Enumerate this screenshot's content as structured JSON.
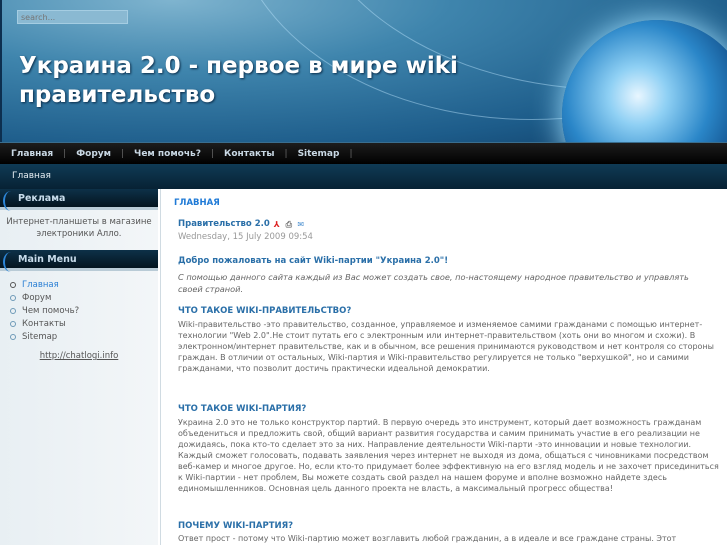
{
  "header": {
    "search_placeholder": "search...",
    "title": "Украина 2.0 - первое в мире wiki правительство"
  },
  "nav": {
    "items": [
      "Главная",
      "Форум",
      "Чем помочь?",
      "Контакты",
      "Sitemap"
    ]
  },
  "breadcrumb": "Главная",
  "sidebar": {
    "ad_title": "Реклама",
    "ad_link": "Интернет-планшеты",
    "ad_text": " в магазине электроники Алло.",
    "menu_title": "Main Menu",
    "menu_items": [
      "Главная",
      "Форум",
      "Чем помочь?",
      "Контакты",
      "Sitemap"
    ],
    "link": "http://chatlogi.info"
  },
  "content": {
    "page_heading": "ГЛАВНАЯ",
    "article_title": "Правительство 2.0",
    "date": "Wednesday, 15 July 2009 09:54",
    "welcome": "Добро пожаловать на сайт Wiki-партии \"Украина 2.0\"!",
    "intro": "С помощью данного сайта каждый из Вас может создать свое, по-настоящему народное правительство и управлять своей страной.",
    "sections": [
      {
        "heading": "ЧТО ТАКОЕ WIKI-ПРАВИТЕЛЬСТВО?",
        "text": "Wiki-правительство  -это правительство, созданное, управляемое и изменяемое самими гражданами с помощью интернет-технологии  \"Web  2.0\".Не стоит путать его с электронным или интернет-правительством  (хоть они во многом и схожи). В электронном/интернет правительстве, как и в обычном, все решения принимаются руководством и нет контроля со стороны граждан. В отличии от остальных,  Wiki-партия и  Wiki-правительство регулируется не только  \"верхушкой\", но и самими гражданами, что позволит достичь практически идеальной демократии."
      },
      {
        "heading": "ЧТО ТАКОЕ WIKI-ПАРТИЯ?",
        "text": "Украина   2.0 это не только конструктор партий. В первую очередь   это инструмент, который дает возможность гражданам объедениться и предложить свой, общий вариант развития государства и самим принимать участие в его реализации не дожидаясь, пока кто-то сделает это за них. Направление деятельности  Wiki-парти  -это инновации и новые технологии. Каждый сможет голосовать, подавать заявления через интернет не выходя из дома, общаться с чиновниками посредством веб-камер и многое другое. Но, если кто-то придумает более эффективную на его взгляд модель и не захочет присединиться к Wiki-партии - нет проблем, Вы можете создать свой раздел на нашем форуме и вполне возможно найдете здесь единомышленников. Основная цель данного проекта не власть, а максимальный прогресс общества!"
      },
      {
        "heading": "ПОЧЕМУ WIKI-ПАРТИЯ?",
        "text": "Ответ прост - потому что Wiki-партию может возглавить любой гражданин, а в идеале и все граждане страны. Этот"
      }
    ]
  }
}
